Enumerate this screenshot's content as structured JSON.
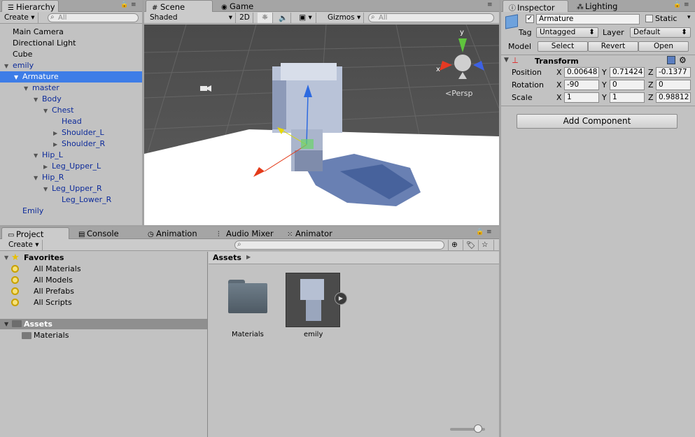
{
  "hierarchy": {
    "tab": "Hierarchy",
    "create": "Create",
    "search_placeholder": "All",
    "items": [
      {
        "label": "Main Camera",
        "tri": "",
        "blue": false
      },
      {
        "label": "Directional Light",
        "tri": "",
        "blue": false
      },
      {
        "label": "Cube",
        "tri": "",
        "blue": false
      },
      {
        "label": "emily",
        "tri": "▼",
        "blue": true
      },
      {
        "label": "Armature",
        "tri": "▼",
        "blue": true
      },
      {
        "label": "master",
        "tri": "▼",
        "blue": true
      },
      {
        "label": "Body",
        "tri": "▼",
        "blue": true
      },
      {
        "label": "Chest",
        "tri": "▼",
        "blue": true
      },
      {
        "label": "Head",
        "tri": "",
        "blue": true
      },
      {
        "label": "Shoulder_L",
        "tri": "▶",
        "blue": true
      },
      {
        "label": "Shoulder_R",
        "tri": "▶",
        "blue": true
      },
      {
        "label": "Hip_L",
        "tri": "▼",
        "blue": true
      },
      {
        "label": "Leg_Upper_L",
        "tri": "▶",
        "blue": true
      },
      {
        "label": "Hip_R",
        "tri": "▼",
        "blue": true
      },
      {
        "label": "Leg_Upper_R",
        "tri": "▼",
        "blue": true
      },
      {
        "label": "Leg_Lower_R",
        "tri": "",
        "blue": true
      },
      {
        "label": "Emily",
        "tri": "",
        "blue": true
      }
    ]
  },
  "scene": {
    "tab_scene": "Scene",
    "tab_game": "Game",
    "shading": "Shaded",
    "mode_2d": "2D",
    "gizmos": "Gizmos",
    "search_placeholder": "All",
    "persp": "Persp",
    "axis_x": "x",
    "axis_y": "y"
  },
  "inspector": {
    "tab_inspector": "Inspector",
    "tab_lighting": "Lighting",
    "object_name": "Armature",
    "static_label": "Static",
    "tag_label": "Tag",
    "tag_value": "Untagged",
    "layer_label": "Layer",
    "layer_value": "Default",
    "model_label": "Model",
    "select": "Select",
    "revert": "Revert",
    "open": "Open",
    "transform_title": "Transform",
    "position_label": "Position",
    "rotation_label": "Rotation",
    "scale_label": "Scale",
    "x": "X",
    "y": "Y",
    "z": "Z",
    "position": {
      "x": "0.00648",
      "y": "0.71424",
      "z": "-0.1377"
    },
    "rotation": {
      "x": "-90",
      "y": "0",
      "z": "0"
    },
    "scale": {
      "x": "1",
      "y": "1",
      "z": "0.98812"
    },
    "add_component": "Add Component"
  },
  "bottom": {
    "tabs": [
      "Project",
      "Console",
      "Animation",
      "Audio Mixer",
      "Animator"
    ],
    "create": "Create",
    "favorites_title": "Favorites",
    "favorites": [
      "All Materials",
      "All Models",
      "All Prefabs",
      "All Scripts"
    ],
    "assets_title": "Assets",
    "assets_children": [
      "Materials"
    ],
    "breadcrumb": "Assets",
    "asset_items": [
      "Materials",
      "emily"
    ]
  }
}
